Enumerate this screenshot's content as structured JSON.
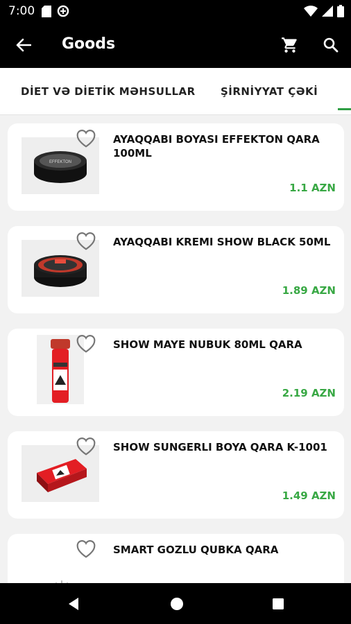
{
  "status_bar": {
    "time": "7:00",
    "left_icons": [
      "sd-card-icon",
      "data-saver-icon"
    ],
    "right_icons": [
      "wifi-icon",
      "signal-icon",
      "battery-icon"
    ]
  },
  "app_bar": {
    "title": "Goods",
    "icons": [
      "back-arrow-icon",
      "cart-icon",
      "search-icon"
    ]
  },
  "tabs": [
    {
      "label": "DİET VƏ DİETİK MƏHSULLAR"
    },
    {
      "label": "ŞİRNİYYAT ÇƏKİ"
    }
  ],
  "products": [
    {
      "title": "AYAQQABI BOYASI EFFEKTON QARA 100ML",
      "price": "1.1 AZN"
    },
    {
      "title": "AYAQQABI KREMI SHOW BLACK 50ML",
      "price": "1.89 AZN"
    },
    {
      "title": "SHOW MAYE NUBUK 80ML QARA",
      "price": "2.19 AZN"
    },
    {
      "title": "SHOW SUNGERLI BOYA QARA K-1001",
      "price": "1.49 AZN"
    },
    {
      "title": "SMART GOZLU QUBKA QARA",
      "price": ""
    }
  ],
  "colors": {
    "accent": "#38a844",
    "app_bar": "#000000",
    "background": "#f2f2f2"
  }
}
